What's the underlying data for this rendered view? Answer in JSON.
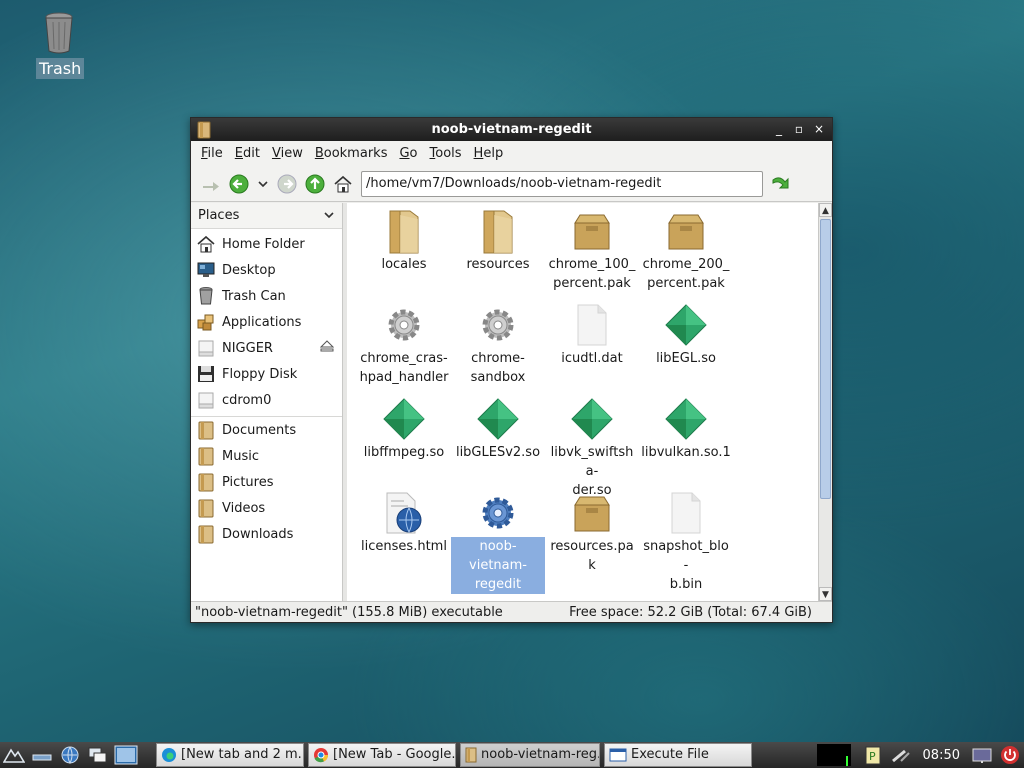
{
  "desktop": {
    "trash_label": "Trash"
  },
  "window": {
    "title": "noob-vietnam-regedit",
    "menu": [
      {
        "label": "File",
        "u": "F",
        "rest": "ile"
      },
      {
        "label": "Edit",
        "u": "E",
        "rest": "dit"
      },
      {
        "label": "View",
        "u": "V",
        "rest": "iew"
      },
      {
        "label": "Bookmarks",
        "u": "B",
        "rest": "ookmarks"
      },
      {
        "label": "Go",
        "u": "G",
        "rest": "o"
      },
      {
        "label": "Tools",
        "u": "T",
        "rest": "ools"
      },
      {
        "label": "Help",
        "u": "H",
        "rest": "elp"
      }
    ],
    "path": "/home/vm7/Downloads/noob-vietnam-regedit",
    "sidebar": {
      "header": "Places",
      "items": [
        {
          "label": "Home Folder"
        },
        {
          "label": "Desktop"
        },
        {
          "label": "Trash Can"
        },
        {
          "label": "Applications"
        },
        {
          "label": "NIGGER"
        },
        {
          "label": "Floppy Disk"
        },
        {
          "label": "cdrom0"
        }
      ],
      "bookmarks": [
        {
          "label": "Documents"
        },
        {
          "label": "Music"
        },
        {
          "label": "Pictures"
        },
        {
          "label": "Videos"
        },
        {
          "label": "Downloads"
        }
      ]
    },
    "files": [
      {
        "name": "locales",
        "icon": "folder"
      },
      {
        "name": "resources",
        "icon": "folder"
      },
      {
        "name": "chrome_100_\npercent.pak",
        "icon": "package"
      },
      {
        "name": "chrome_200_\npercent.pak",
        "icon": "package"
      },
      {
        "name": "chrome_cras-\nhpad_handler",
        "icon": "gear"
      },
      {
        "name": "chrome-\nsandbox",
        "icon": "gear"
      },
      {
        "name": "icudtl.dat",
        "icon": "file"
      },
      {
        "name": "libEGL.so",
        "icon": "library"
      },
      {
        "name": "libffmpeg.so",
        "icon": "library"
      },
      {
        "name": "libGLESv2.so",
        "icon": "library"
      },
      {
        "name": "libvk_swiftsha-\nder.so",
        "icon": "library"
      },
      {
        "name": "libvulkan.so.1",
        "icon": "library"
      },
      {
        "name": "licenses.html",
        "icon": "html"
      },
      {
        "name": "noob-\nvietnam-\nregedit",
        "icon": "gear-blue",
        "selected": true
      },
      {
        "name": "resources.pak",
        "icon": "package"
      },
      {
        "name": "snapshot_blo-\nb.bin",
        "icon": "file"
      }
    ],
    "status_left": "\"noob-vietnam-regedit\" (155.8 MiB) executable",
    "status_right": "Free space: 52.2 GiB (Total: 67.4 GiB)"
  },
  "taskbar": {
    "tasks": [
      {
        "label": "[New tab and 2 m...",
        "icon": "edge-icon"
      },
      {
        "label": "[New Tab - Google...",
        "icon": "chrome-icon"
      },
      {
        "label": "noob-vietnam-reg...",
        "icon": "folder-icon",
        "active": true
      },
      {
        "label": "Execute File",
        "icon": "window-icon"
      }
    ],
    "clock": "08:50"
  }
}
